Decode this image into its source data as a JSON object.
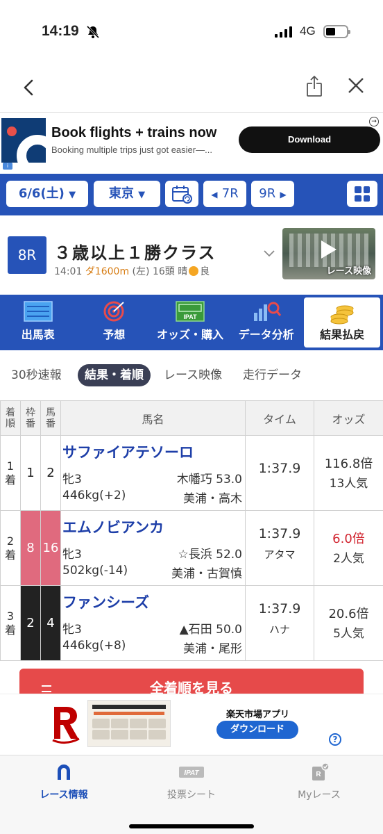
{
  "status_bar": {
    "time": "14:19",
    "network": "4G"
  },
  "ad_top": {
    "title": "Book flights + trains now",
    "subtitle": "Booking multiple trips just got easier—...",
    "button": "Download",
    "info_badge": "i"
  },
  "race_nav": {
    "date": "6/6(土)",
    "venue": "東京",
    "prev_race": "7R",
    "next_race": "9R"
  },
  "race": {
    "number": "8R",
    "title": "３歳以上１勝クラス",
    "start_time": "14:01",
    "distance": "ダ1600m",
    "direction": "(左)",
    "runners": "16頭",
    "weather": "晴",
    "track": "良",
    "video_label": "レース映像"
  },
  "main_tabs": [
    {
      "label": "出馬表",
      "icon": "race-card-icon"
    },
    {
      "label": "予想",
      "icon": "target-icon"
    },
    {
      "label": "オッズ・購入",
      "icon": "ipat-icon"
    },
    {
      "label": "データ分析",
      "icon": "chart-search-icon"
    },
    {
      "label": "結果払戻",
      "icon": "coins-icon",
      "active": true
    }
  ],
  "sub_tabs": [
    {
      "label": "30秒速報"
    },
    {
      "label": "結果・着順",
      "active": true
    },
    {
      "label": "レース映像"
    },
    {
      "label": "走行データ"
    }
  ],
  "table": {
    "headers": {
      "rank": "着順",
      "frame": "枠番",
      "number": "馬番",
      "name": "馬名",
      "time": "タイム",
      "odds": "オッズ"
    },
    "rows": [
      {
        "rank": "1着",
        "frame": "1",
        "number": "2",
        "name": "サファイアテソーロ",
        "sex_age": "牝3",
        "jockey_weight": "木幡巧 53.0",
        "body_weight": "446kg(+2)",
        "trainer": "美浦・高木",
        "time": "1:37.9",
        "margin": "",
        "odds": "116.8倍",
        "popularity": "13人気"
      },
      {
        "rank": "2着",
        "frame": "8",
        "number": "16",
        "name": "エムノビアンカ",
        "sex_age": "牝3",
        "jockey_weight": "☆長浜 52.0",
        "body_weight": "502kg(-14)",
        "trainer": "美浦・古賀慎",
        "time": "1:37.9",
        "margin": "アタマ",
        "odds": "6.0倍",
        "popularity": "2人気"
      },
      {
        "rank": "3着",
        "frame": "2",
        "number": "4",
        "name": "ファンシーズ",
        "sex_age": "牝3",
        "jockey_weight": "▲石田 50.0",
        "body_weight": "446kg(+8)",
        "trainer": "美浦・尾形",
        "time": "1:37.9",
        "margin": "ハナ",
        "odds": "20.6倍",
        "popularity": "5人気"
      }
    ]
  },
  "all_order_button": "全着順を見る",
  "ad_bottom": {
    "app_title": "楽天市場アプリ",
    "button": "ダウンロード",
    "help": "?"
  },
  "bottom_nav": [
    {
      "label": "レース情報",
      "active": true
    },
    {
      "label": "投票シート"
    },
    {
      "label": "Myレース"
    }
  ],
  "colors": {
    "primary_blue": "#2653b8",
    "frame_pink": "#e06a7e",
    "frame_black": "#222222",
    "odds_highlight": "#d1242f",
    "all_order_red": "#e64a4a"
  }
}
